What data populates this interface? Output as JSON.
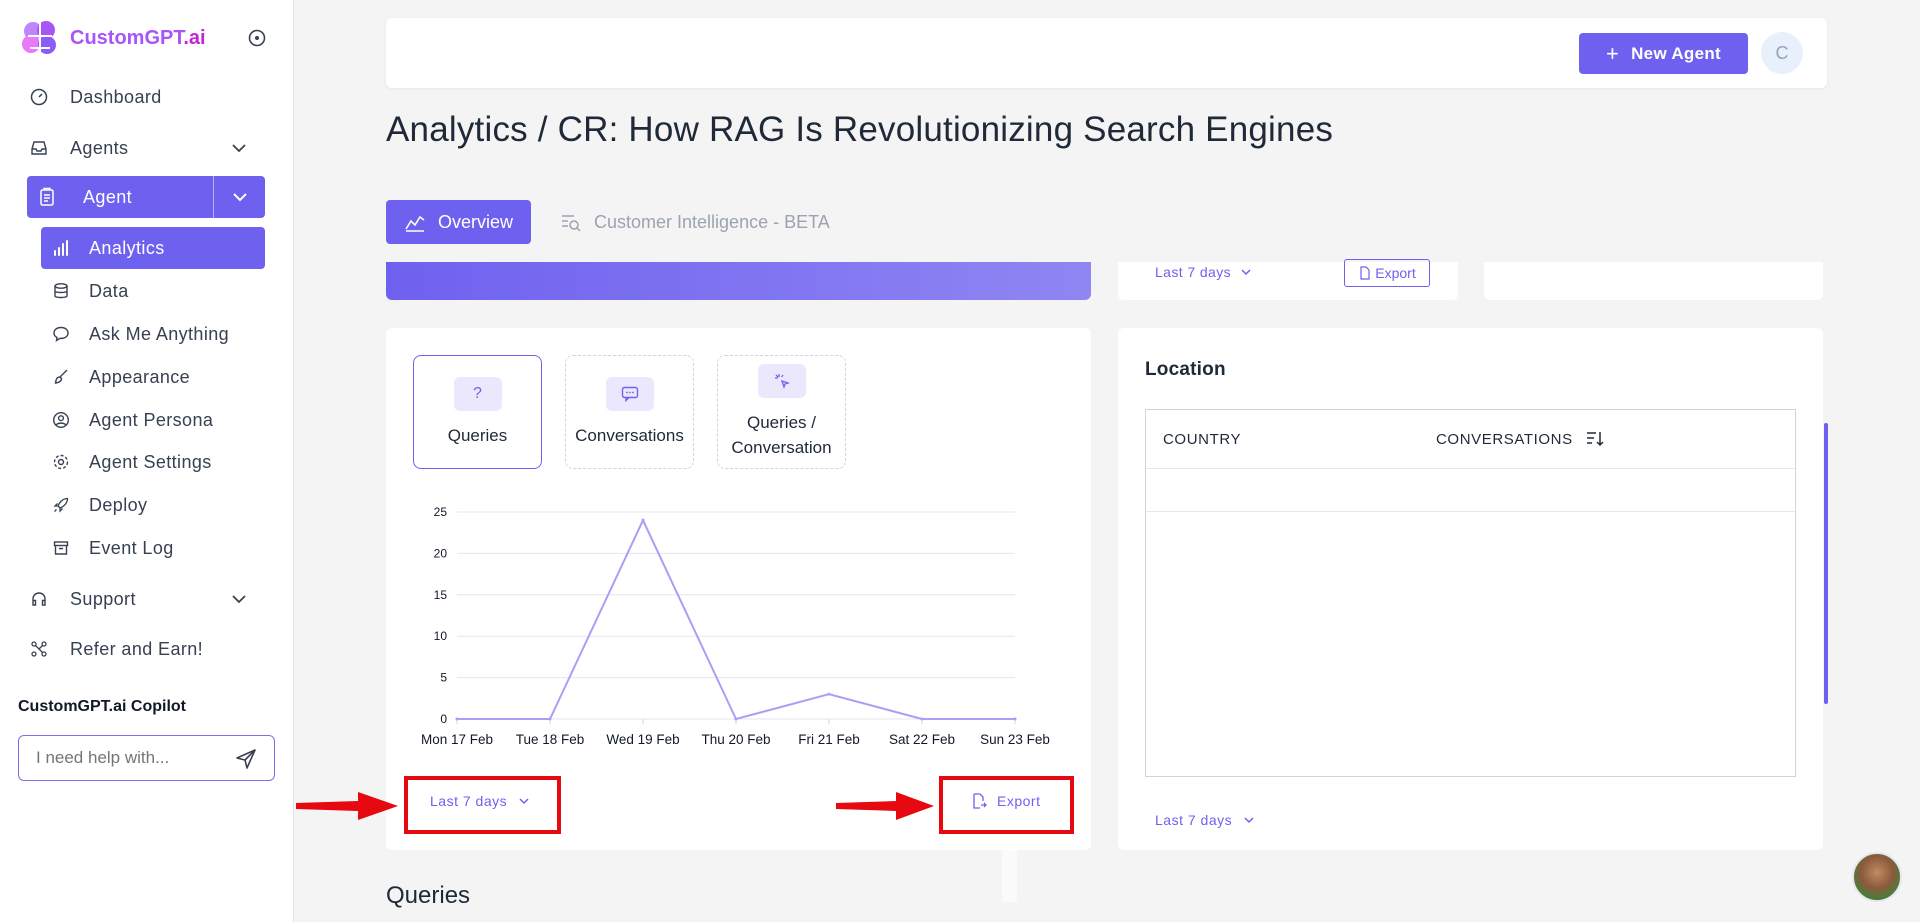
{
  "brand": {
    "name_main": "CustomGPT",
    "name_suffix": ".ai"
  },
  "sidebar": {
    "dashboard": "Dashboard",
    "agents": "Agents",
    "agent": "Agent",
    "sub_items": [
      "Analytics",
      "Data",
      "Ask Me Anything",
      "Appearance",
      "Agent Persona",
      "Agent Settings",
      "Deploy",
      "Event Log"
    ],
    "support": "Support",
    "refer": "Refer and Earn!",
    "copilot_title": "CustomGPT.ai Copilot",
    "copilot_placeholder": "I need help with..."
  },
  "header": {
    "new_agent": "New Agent",
    "avatar_initial": "C"
  },
  "page_title": "Analytics / CR: How RAG Is Revolutionizing Search Engines",
  "tabs": {
    "overview": "Overview",
    "customer_intelligence": "Customer Intelligence - BETA"
  },
  "top_cards": {
    "range": "Last 7 days",
    "export": "Export"
  },
  "metrics": {
    "queries": "Queries",
    "conversations": "Conversations",
    "qpc_line1": "Queries /",
    "qpc_line2": "Conversation",
    "queries_icon": "?"
  },
  "chart_controls": {
    "range": "Last 7 days",
    "export": "Export"
  },
  "chart_data": {
    "type": "line",
    "categories": [
      "Mon 17 Feb",
      "Tue 18 Feb",
      "Wed 19 Feb",
      "Thu 20 Feb",
      "Fri 21 Feb",
      "Sat 22 Feb",
      "Sun 23 Feb"
    ],
    "values": [
      0,
      0,
      24,
      0,
      3,
      0,
      0
    ],
    "yticks": [
      0,
      5,
      10,
      15,
      20,
      25
    ],
    "ylim": [
      0,
      25
    ],
    "color": "#a99ff5",
    "grid": true
  },
  "location": {
    "title": "Location",
    "col_country": "COUNTRY",
    "col_conversations": "CONVERSATIONS",
    "range": "Last 7 days"
  },
  "queries_heading": "Queries",
  "colors": {
    "accent": "#6f61ef",
    "highlight": "#e6090f"
  }
}
